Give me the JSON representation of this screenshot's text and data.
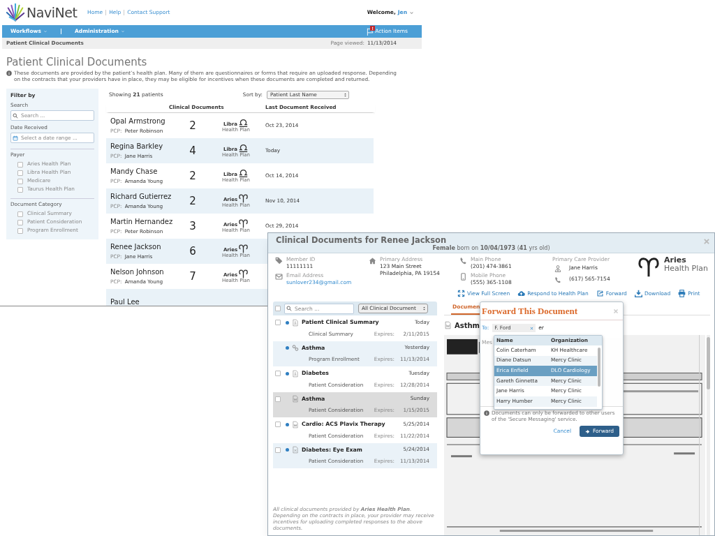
{
  "header": {
    "brand": "NaviNet",
    "links": [
      "Home",
      "Help",
      "Contact Support"
    ],
    "welcome": "Welcome,",
    "user": "Jen"
  },
  "nav": {
    "menus": [
      "Workflows",
      "Administration"
    ],
    "action_items": "Action Items",
    "alert_badge": "!"
  },
  "breadcrumb": {
    "title": "Patient Clinical Documents",
    "viewed_label": "Page viewed:",
    "viewed_date": "11/13/2014"
  },
  "page": {
    "title": "Patient Clinical Documents",
    "info": "These documents are provided by the patient’s health plan. Many of them are questionnaires or forms that require an uploaded response. Depending on the contracts that your providers have in place, they may be eligible for incentives when these documents are completed and returned."
  },
  "filter": {
    "title": "Filter by",
    "search_label": "Search",
    "search_placeholder": "Search ...",
    "date_label": "Date Received",
    "date_placeholder": "Select a date range ...",
    "groups": [
      {
        "title": "Payer",
        "options": [
          {
            "label": "Aries Health Plan",
            "checked": false
          },
          {
            "label": "Libra Health Plan",
            "checked": false
          },
          {
            "label": "Medicare",
            "checked": false
          },
          {
            "label": "Taurus Health Plan",
            "checked": false
          }
        ]
      },
      {
        "title": "Document Category",
        "options": [
          {
            "label": "Clinical Summary",
            "checked": false
          },
          {
            "label": "Patient Consideration",
            "checked": false
          },
          {
            "label": "Program Enrollment",
            "checked": false
          }
        ]
      }
    ]
  },
  "patients": {
    "showing": "Showing **21** patients",
    "sort_label": "Sort by:",
    "sort_value": "Patient Last Name",
    "columns": [
      "Clinical Documents",
      "Last Document Received"
    ],
    "rows": [
      {
        "name": "Opal Armstrong",
        "pcp_label": "PCP:",
        "pcp": "Peter Robinson",
        "count": "2",
        "kind": "libra",
        "plan_name": "Libra",
        "plan_sub": "Health Plan",
        "last": "Oct 23, 2014"
      },
      {
        "name": "Regina Barkley",
        "pcp_label": "PCP:",
        "pcp": "Jane Harris",
        "count": "4",
        "kind": "libra",
        "plan_name": "Libra",
        "plan_sub": "Health Plan",
        "last": "Today"
      },
      {
        "name": "Mandy Chase",
        "pcp_label": "PCP:",
        "pcp": "Amanda Young",
        "count": "2",
        "kind": "libra",
        "plan_name": "Libra",
        "plan_sub": "Health Plan",
        "last": "Oct 14, 2014"
      },
      {
        "name": "Richard Gutierrez",
        "pcp_label": "PCP:",
        "pcp": "Amanda Young",
        "count": "2",
        "kind": "aries",
        "plan_name": "Aries",
        "plan_sub": "Health Plan",
        "last": "Nov 10, 2014"
      },
      {
        "name": "Martin Hernandez",
        "pcp_label": "PCP:",
        "pcp": "Peter Robinson",
        "count": "3",
        "kind": "aries",
        "plan_name": "Aries",
        "plan_sub": "Health Plan",
        "last": "Oct 29, 2014"
      },
      {
        "name": "Renee Jackson",
        "pcp_label": "PCP:",
        "pcp": "Jane Harris",
        "count": "6",
        "kind": "aries",
        "plan_name": "Aries",
        "plan_sub": "Health Plan"
      },
      {
        "name": "Nelson Johnson",
        "pcp_label": "PCP:",
        "pcp": "Amanda Young",
        "count": "7",
        "kind": "aries",
        "plan_name": "Aries",
        "plan_sub": "Health Plan"
      },
      {
        "name": "Paul Lee"
      }
    ]
  },
  "modal": {
    "title": "Clinical Documents for Renee Jackson",
    "subtitle": "**Female** born on **10/04/1973** (**41** yrs old)",
    "columns": [
      {
        "entries": [
          {
            "kind": "tag",
            "label": "Member ID",
            "lines": [
              "11111111"
            ]
          },
          {
            "kind": "email",
            "label": "Email Address",
            "lines": [
              "sunlover234@gmail.com"
            ]
          }
        ]
      },
      {
        "entries": [
          {
            "kind": "home",
            "label": "Primary Address",
            "lines": [
              "123 Main Street",
              "Philadelphia, PA 19154"
            ]
          }
        ]
      },
      {
        "entries": [
          {
            "kind": "phone",
            "label": "Main Phone",
            "lines": [
              "(201) 474-3861"
            ]
          },
          {
            "kind": "mobile",
            "label": "Mobile Phone",
            "lines": [
              "(555) 365-1108"
            ]
          }
        ]
      },
      {
        "heading": "Primary Care Provider",
        "entries": [
          {
            "kind": "doctor",
            "lines": [
              "Jane Harris"
            ]
          },
          {
            "kind": "phone",
            "lines": [
              "(617) 565-7154"
            ]
          }
        ]
      }
    ],
    "plan": {
      "kind": "aries",
      "name": "Aries",
      "sub": "Health Plan"
    },
    "actions": [
      {
        "kind": "fullscreen",
        "label": "View Full Screen"
      },
      {
        "kind": "upload",
        "label": "Respond to Health Plan"
      },
      {
        "kind": "forward",
        "label": "Forward"
      },
      {
        "kind": "download",
        "label": "Download"
      },
      {
        "kind": "print",
        "label": "Print"
      }
    ]
  },
  "documents": {
    "select_all_checked": false,
    "search_placeholder": "Search ...",
    "filter_value": "All Clinical Document",
    "rows": [
      {
        "title": "Patient Clinical Summary",
        "date": "Today",
        "category": "Clinical Summary",
        "expires_label": "Expires:",
        "expires": "2/11/2015",
        "unread": true,
        "checkable": true,
        "kind": "pdf",
        "selected": false
      },
      {
        "title": "Asthma",
        "date": "Yesterday",
        "category": "Program Enrollment",
        "expires_label": "Expires:",
        "expires": "11/13/2014",
        "unread": true,
        "checkable": false,
        "kind": "link",
        "selected": false
      },
      {
        "title": "Diabetes",
        "date": "Tuesday",
        "category": "Patient Consideration",
        "expires_label": "Expires:",
        "expires": "12/28/2014",
        "unread": true,
        "checkable": true,
        "kind": "pdf",
        "selected": false
      },
      {
        "title": "Asthma",
        "date": "Sunday",
        "category": "Patient Consideration",
        "expires_label": "Expires:",
        "expires": "1/15/2015",
        "unread": false,
        "checkable": true,
        "kind": "word",
        "selected": true
      },
      {
        "title": "Cardio: ACS Plavix Therapy",
        "date": "5/25/2014",
        "category": "Patient Consideration",
        "expires_label": "Expires:",
        "expires": "11/22/2014",
        "unread": true,
        "checkable": true,
        "kind": "word",
        "selected": false
      },
      {
        "title": "Diabetes: Eye Exam",
        "date": "5/24/2014",
        "category": "Patient Consideration",
        "expires_label": "Expires:",
        "expires": "11/13/2014",
        "unread": true,
        "checkable": true,
        "kind": "excel",
        "selected": false
      }
    ],
    "footer": "All clinical documents provided by **Aries Health Plan**. Depending on the contracts in place, your provider may receive incentives for uploading completed responses to the above documents."
  },
  "viewer": {
    "tab": "Documen",
    "doc_title": "Asthm",
    "kind": "word"
  },
  "forward": {
    "title": "Forward This Document",
    "to_label": "To:",
    "recipients": [
      "F. Ford"
    ],
    "typed": "er",
    "message_placeholder": "Mes",
    "suggestions": {
      "columns": [
        "Name",
        "Organization"
      ],
      "rows": [
        {
          "name": "Colin Caterham",
          "org": "KH Healthcare",
          "selected": false
        },
        {
          "name": "Diane Datsun",
          "org": "Mercy Clinic",
          "selected": false
        },
        {
          "name": "Erica Enfield",
          "org": "DLO Cardiology",
          "selected": true
        },
        {
          "name": "Gareth Ginnetta",
          "org": "Mercy Clinic",
          "selected": false
        },
        {
          "name": "Jane Harris",
          "org": "Mercy Clinic",
          "selected": false
        },
        {
          "name": "Harry Humber",
          "org": "Mercy Clinic",
          "selected": false
        }
      ]
    },
    "info": "Documents can only be forwarded to other users of the 'Secure Messaging' service.",
    "cancel": "Cancel",
    "submit": "Forward"
  }
}
